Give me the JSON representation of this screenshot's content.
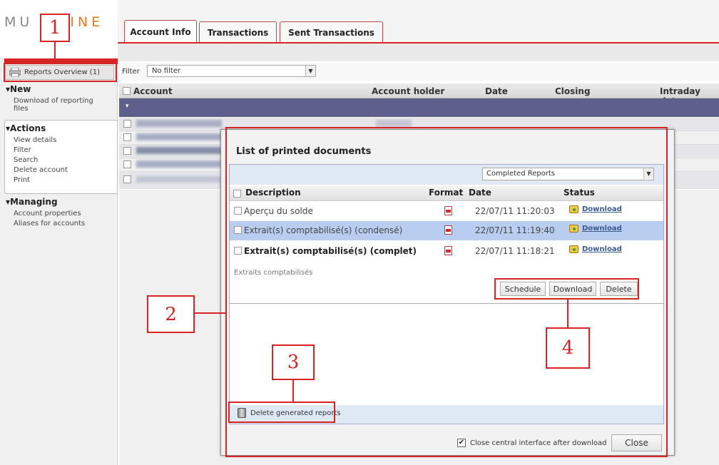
{
  "logo": {
    "left": "MU",
    "right": "INE"
  },
  "tabs": [
    {
      "label": "Account Info"
    },
    {
      "label": "Transactions"
    },
    {
      "label": "Sent Transactions"
    }
  ],
  "sidebar": {
    "reports_overview": "Reports Overview (1)",
    "new_heading": "New",
    "new_items": [
      "Download of reporting files"
    ],
    "actions_heading": "Actions",
    "actions_items": [
      "View details",
      "Filter",
      "Search",
      "Delete account",
      "Print"
    ],
    "managing_heading": "Managing",
    "managing_items": [
      "Account properties",
      "Aliases for accounts"
    ]
  },
  "filter": {
    "label": "Filter",
    "value": "No filter"
  },
  "table": {
    "columns": [
      "Account",
      "Account holder",
      "Date",
      "Closing",
      "Intraday date"
    ]
  },
  "dialog": {
    "title": "List of printed documents",
    "report_select": "Completed Reports",
    "columns": [
      "Description",
      "Format",
      "Date",
      "Status"
    ],
    "rows": [
      {
        "description": "Aperçu du solde",
        "format": "pdf-icon",
        "date": "22/07/11 11:20:03",
        "status": "Download"
      },
      {
        "description": "Extrait(s) comptabilisé(s) (condensé)",
        "format": "pdf-icon",
        "date": "22/07/11 11:19:40",
        "status": "Download"
      },
      {
        "description": "Extrait(s) comptabilisé(s) (complet)",
        "format": "pdf-icon",
        "date": "22/07/11 11:18:21",
        "status": "Download"
      }
    ],
    "info_text": "Extraits comptabilisés",
    "buttons": {
      "schedule": "Schedule",
      "download": "Download",
      "delete": "Delete"
    },
    "delete_generated": "Delete generated reports",
    "close_after_download": "Close central interface after download",
    "close_button": "Close"
  },
  "annotations": [
    "1",
    "2",
    "3",
    "4"
  ],
  "colors": {
    "accent_red": "#d62424",
    "header_purple": "#5e5f8a",
    "selected_row": "#b9cdf0"
  }
}
